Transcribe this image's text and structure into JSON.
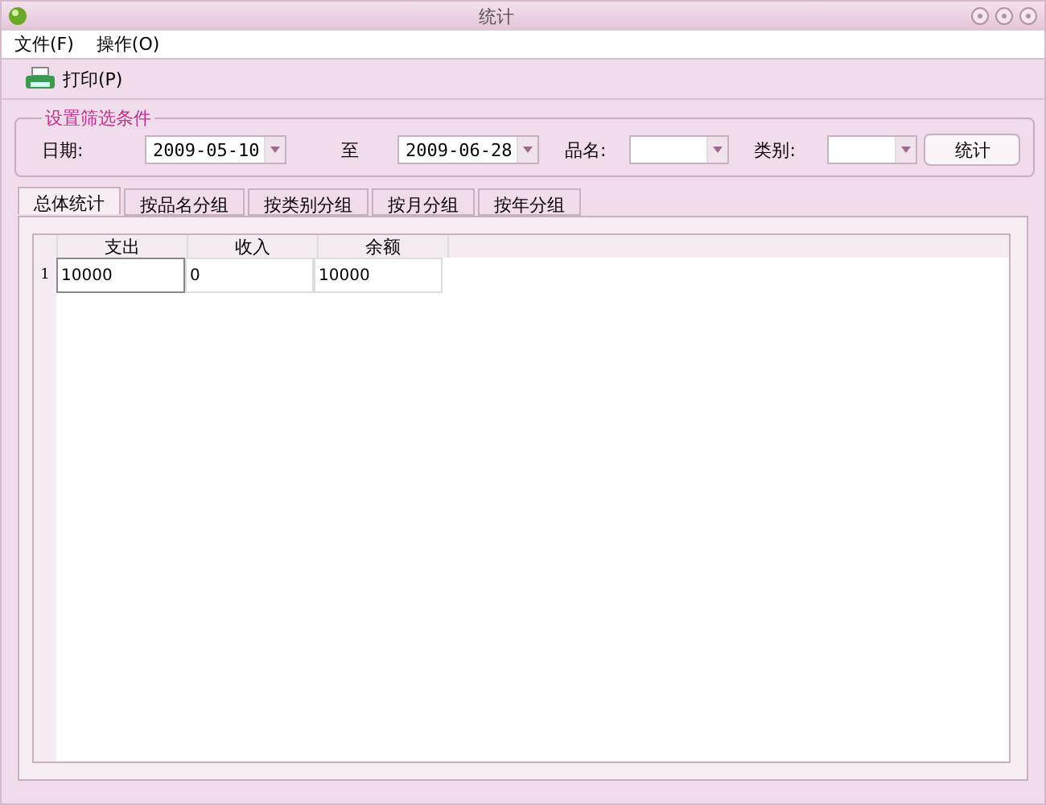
{
  "window": {
    "title": "统计"
  },
  "menu": [
    "文件(F)",
    "操作(O)"
  ],
  "toolbar": {
    "print": "打印(P)"
  },
  "filter": {
    "title": "设置筛选条件",
    "date_label": "日期:",
    "date_from": "2009-05-10",
    "to_label": "至",
    "date_to": "2009-06-28",
    "name_label": "品名:",
    "category_label": "类别:",
    "button": "统计"
  },
  "tabs": [
    {
      "label": "总体统计",
      "selected": true
    },
    {
      "label": "按品名分组",
      "selected": false
    },
    {
      "label": "按类别分组",
      "selected": false
    },
    {
      "label": "按月分组",
      "selected": false
    },
    {
      "label": "按年分组",
      "selected": false
    }
  ],
  "table": {
    "columns": [
      "支出",
      "收入",
      "余额"
    ],
    "rows": [
      {
        "number": "1",
        "cells": [
          "10000",
          "0",
          "10000"
        ]
      }
    ]
  }
}
